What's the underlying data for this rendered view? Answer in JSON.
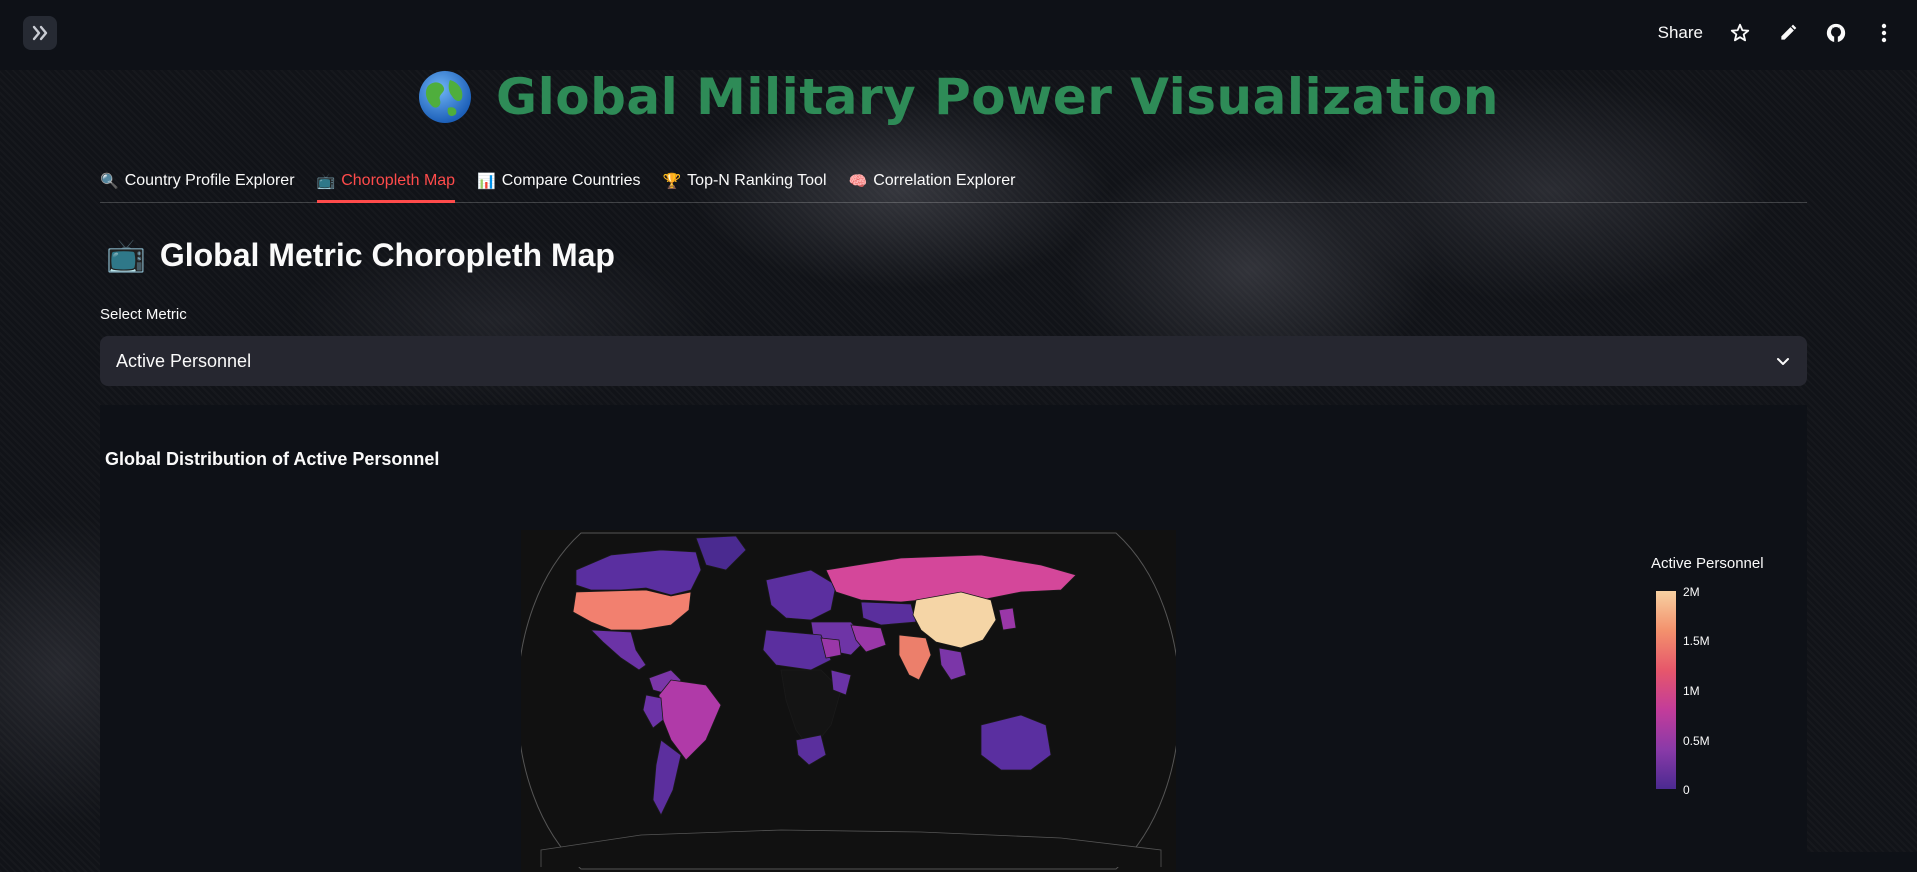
{
  "app": {
    "share_label": "Share",
    "title": "Global Military Power Visualization"
  },
  "tabs": [
    {
      "icon": "🔍",
      "label": "Country Profile Explorer",
      "active": false
    },
    {
      "icon": "📺",
      "label": "Choropleth Map",
      "active": true
    },
    {
      "icon": "📊",
      "label": "Compare Countries",
      "active": false
    },
    {
      "icon": "🏆",
      "label": "Top-N Ranking Tool",
      "active": false
    },
    {
      "icon": "🧠",
      "label": "Correlation Explorer",
      "active": false
    }
  ],
  "section": {
    "icon": "📺",
    "heading": "Global Metric Choropleth Map",
    "select_label": "Select Metric",
    "select_value": "Active Personnel"
  },
  "chart": {
    "title": "Global Distribution of Active Personnel",
    "colorbar_title": "Active Personnel",
    "colorbar_ticks": [
      "2M",
      "1.5M",
      "1M",
      "0.5M",
      "0"
    ]
  },
  "chart_data": {
    "type": "heatmap",
    "title": "Global Distribution of Active Personnel",
    "colorbar_title": "Active Personnel",
    "range": [
      0,
      2000000
    ],
    "tick_labels": [
      "0",
      "0.5M",
      "1M",
      "1.5M",
      "2M"
    ],
    "colorscale": [
      "#4b2a91",
      "#8a3aa8",
      "#c33c9a",
      "#e6576b",
      "#f3916d",
      "#f7d1a2"
    ],
    "highlighted_regions": [
      {
        "region": "China",
        "value": 2000000
      },
      {
        "region": "India",
        "value": 1450000
      },
      {
        "region": "United States",
        "value": 1390000
      },
      {
        "region": "Russia",
        "value": 1150000
      },
      {
        "region": "Brazil",
        "value": 380000
      },
      {
        "region": "Canada",
        "value": 70000
      },
      {
        "region": "Australia",
        "value": 60000
      }
    ]
  },
  "colors": {
    "title_green": "#2e8b57",
    "tab_active": "#ff4b4b",
    "background": "#0e1117"
  }
}
